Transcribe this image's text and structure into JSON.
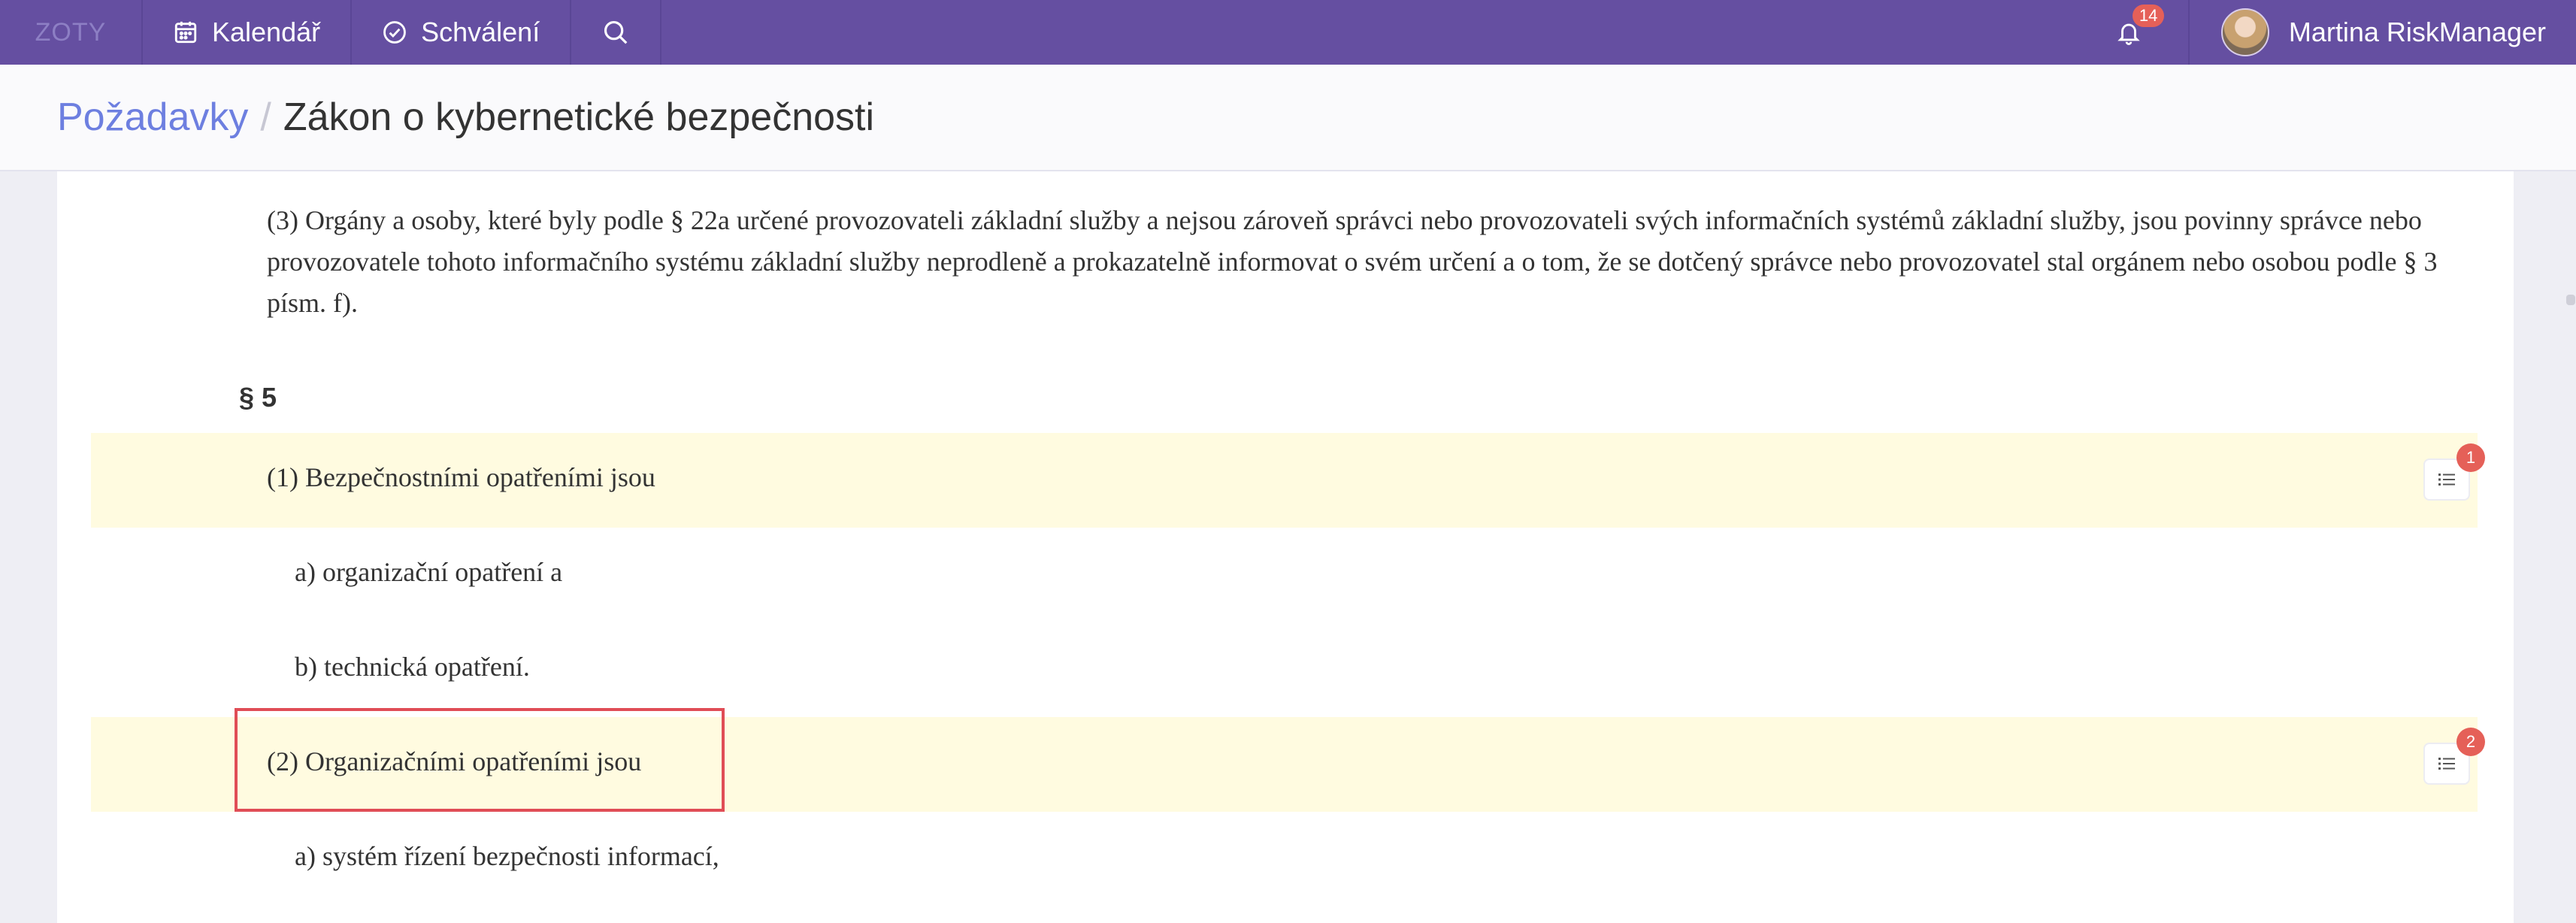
{
  "nav": {
    "brand": "ZOTY",
    "calendar_label": "Kalendář",
    "approvals_label": "Schválení",
    "notification_count": "14",
    "user_name": "Martina RiskManager"
  },
  "breadcrumb": {
    "parent": "Požadavky",
    "separator": "/",
    "current": "Zákon o kybernetické bezpečnosti"
  },
  "document": {
    "paragraph_3": "(3) Orgány a osoby, které byly podle § 22a určené provozovateli základní služby a nejsou zároveň správci nebo provozovateli svých informačních systémů základní služby, jsou povinny správce nebo provozovatele tohoto informačního systému základní služby neprodleně a prokazatelně informovat o svém určení a o tom, že se dotčený správce nebo provozovatel stal orgánem nebo osobou podle § 3 písm. f).",
    "section_heading": "§ 5",
    "items": [
      {
        "text": "(1) Bezpečnostními opatřeními jsou",
        "highlighted": true,
        "requirements_count": "1"
      },
      {
        "text": "a) organizační opatření a",
        "highlighted": false
      },
      {
        "text": "b) technická opatření.",
        "highlighted": false
      },
      {
        "text": "(2) Organizačními opatřeními jsou",
        "highlighted": true,
        "requirements_count": "2"
      },
      {
        "text": "a) systém řízení bezpečnosti informací,",
        "highlighted": false
      }
    ]
  },
  "colors": {
    "topbar": "#654fa1",
    "highlight_row": "#fffbe0",
    "badge": "#e56058",
    "breadcrumb_link": "#6d7fe0",
    "selection_outline": "#e04d56"
  }
}
